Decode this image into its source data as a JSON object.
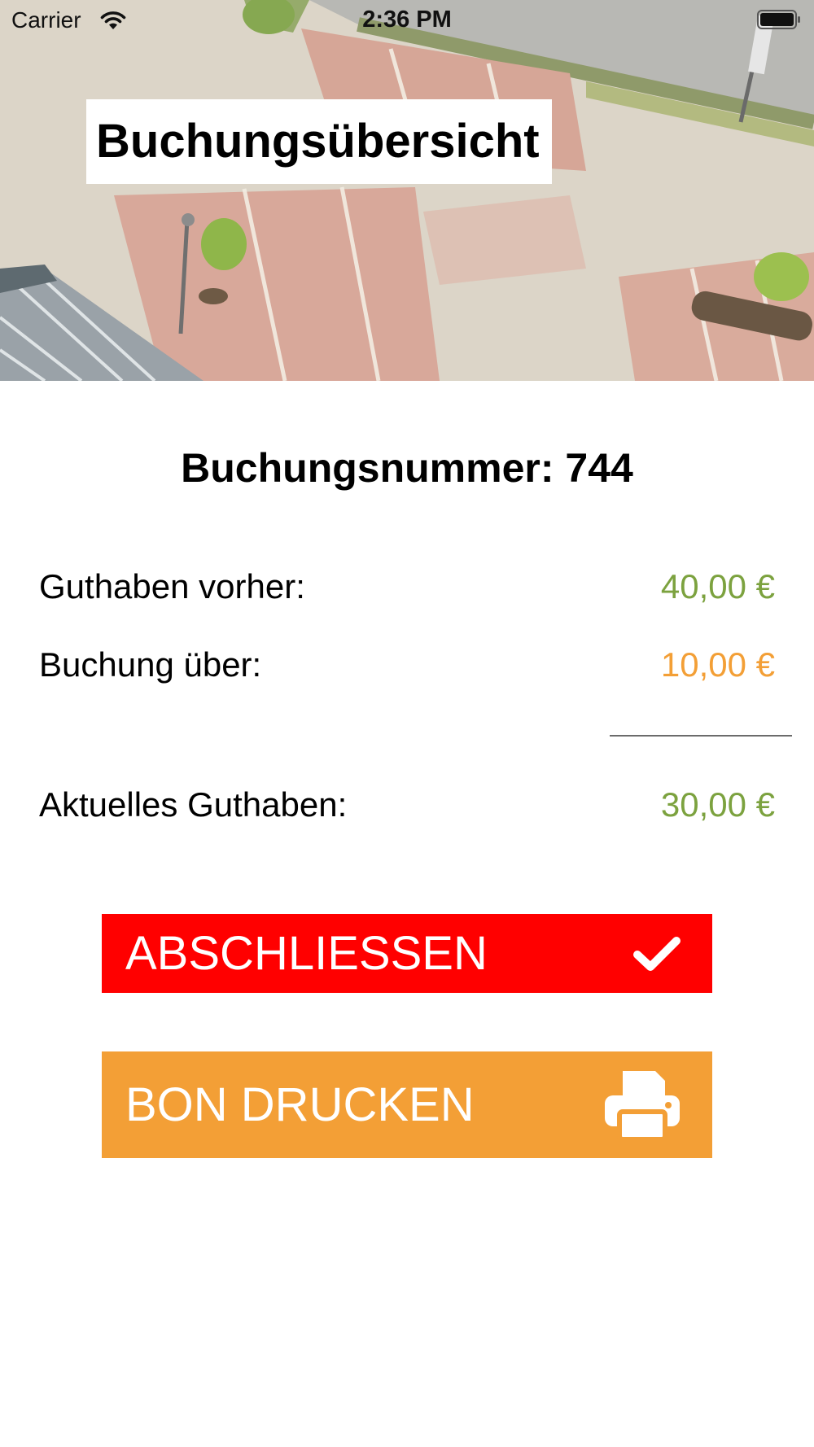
{
  "status_bar": {
    "carrier": "Carrier",
    "time": "2:36 PM"
  },
  "header": {
    "title": "Buchungsübersicht"
  },
  "booking": {
    "number_label": "Buchungsnummer: 744"
  },
  "summary": {
    "before_label": "Guthaben vorher:",
    "before_value": "40,00 €",
    "booking_label": "Buchung über:",
    "booking_value": "10,00 €",
    "current_label": "Aktuelles Guthaben:",
    "current_value": "30,00 €"
  },
  "actions": {
    "close_label": "ABSCHLIESSEN",
    "print_label": "BON DRUCKEN"
  },
  "colors": {
    "positive": "#7ca23f",
    "booking": "#f39f36",
    "close_button": "#ff0000",
    "print_button": "#f39f36"
  },
  "icons": {
    "close": "checkmark-icon",
    "print": "printer-icon",
    "wifi": "wifi-icon",
    "battery": "battery-icon"
  }
}
